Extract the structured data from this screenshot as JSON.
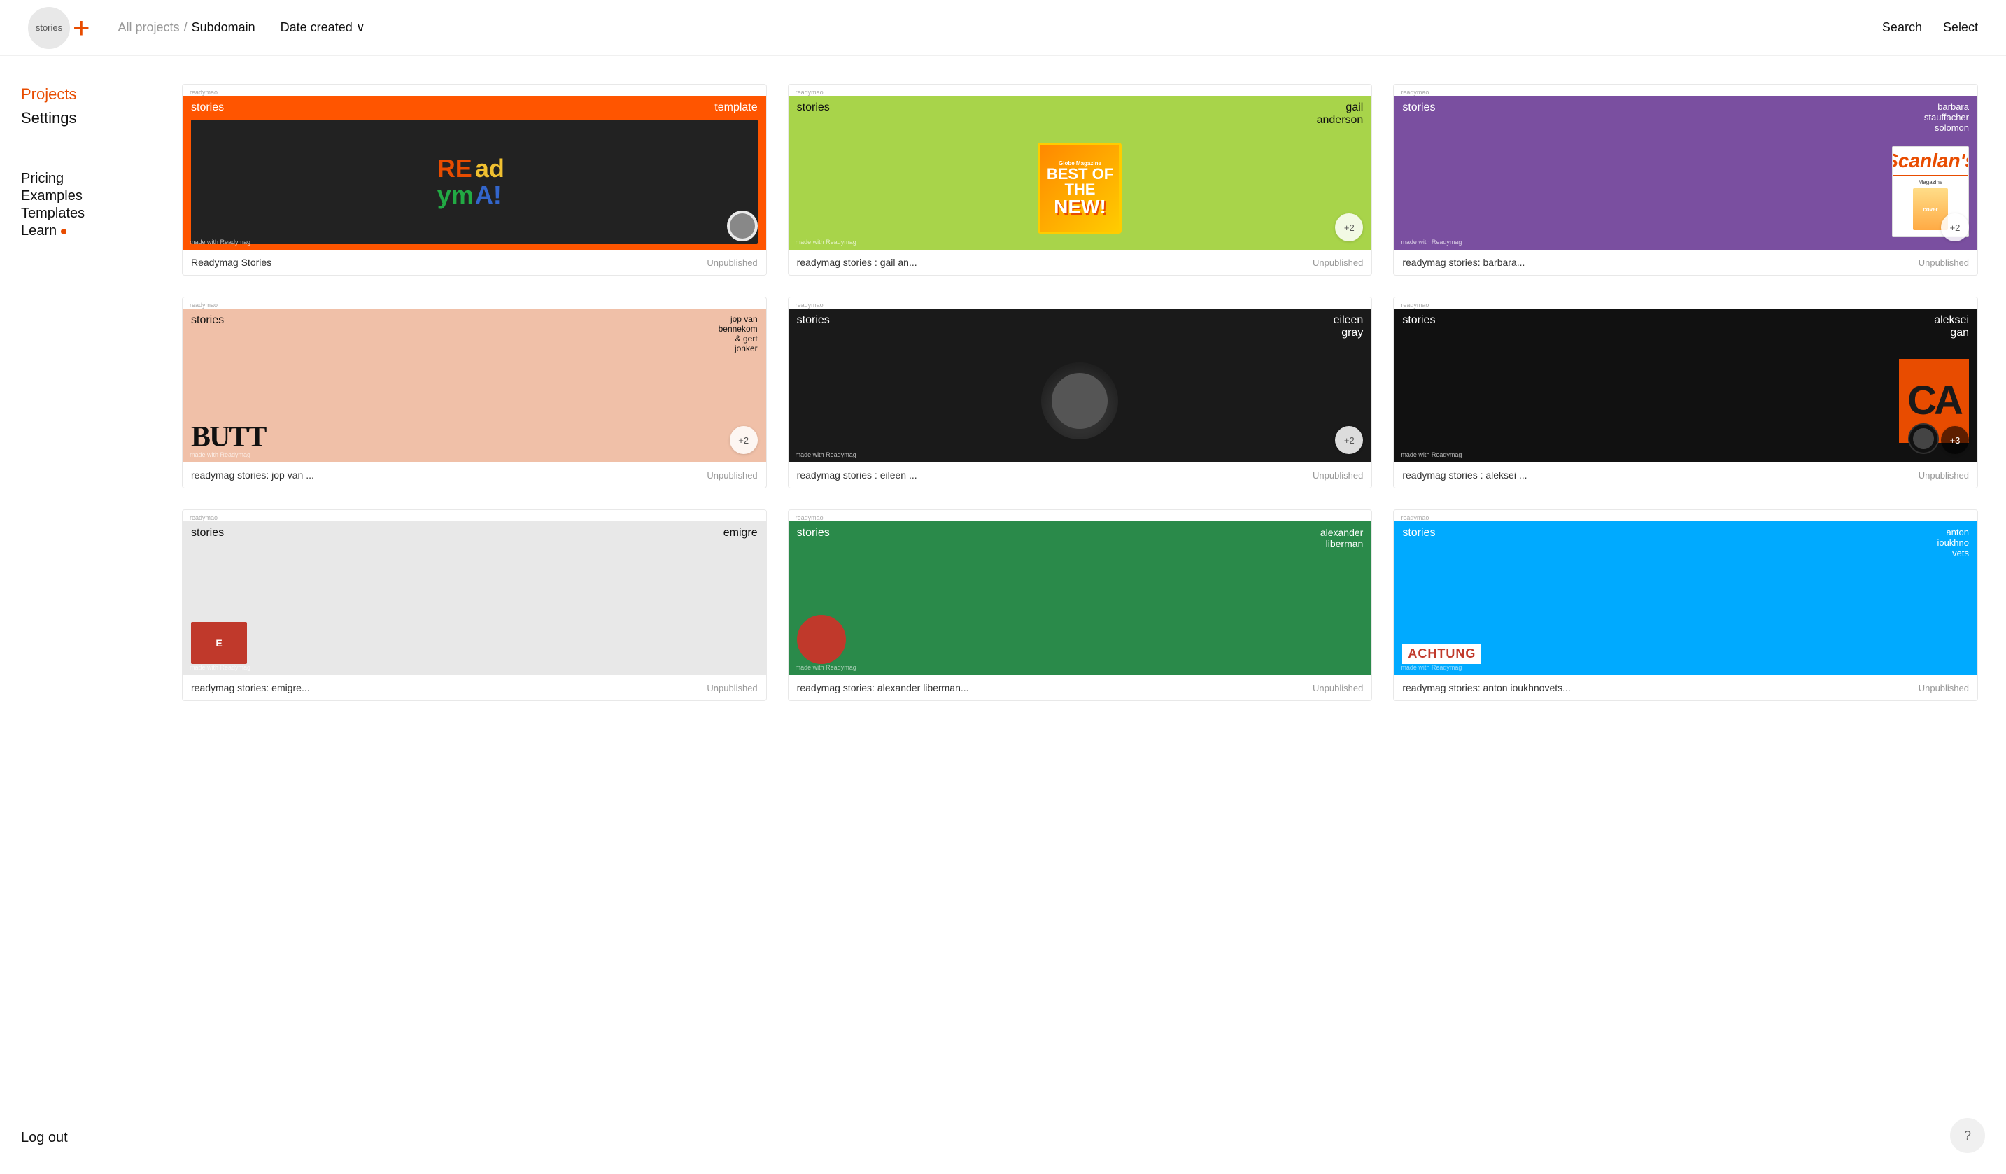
{
  "header": {
    "logo_text": "stories",
    "logo_plus": "+",
    "breadcrumb_all": "All projects",
    "breadcrumb_sep": "/",
    "breadcrumb_current": "Subdomain",
    "date_sort": "Date created ∨",
    "search_label": "Search",
    "select_label": "Select"
  },
  "sidebar": {
    "nav_items": [
      {
        "label": "Projects",
        "active": true
      },
      {
        "label": "Settings",
        "active": false
      }
    ],
    "external_items": [
      {
        "label": "Pricing",
        "badge": false
      },
      {
        "label": "Examples",
        "badge": false
      },
      {
        "label": "Templates",
        "badge": false
      },
      {
        "label": "Learn",
        "badge": true
      }
    ],
    "logout_label": "Log out"
  },
  "projects": [
    {
      "id": 1,
      "top_label": "readymao",
      "title": "Readymag Stories",
      "status": "Unpublished",
      "thumb_type": "template",
      "stories_label": "stories",
      "name_label": "template",
      "badge": null,
      "bg": "#ff5500"
    },
    {
      "id": 2,
      "top_label": "readymao",
      "title": "readymag stories : gail an...",
      "status": "Unpublished",
      "thumb_type": "gail",
      "stories_label": "stories",
      "name_label": "gail anderson",
      "badge": "+2",
      "bg": "#a8d44a"
    },
    {
      "id": 3,
      "top_label": "readymao",
      "title": "readymag stories: barbara...",
      "status": "Unpublished",
      "thumb_type": "barbara",
      "stories_label": "stories",
      "name_label": "barbara stauffacher solomon",
      "badge": "+2",
      "bg": "#7a4fa0"
    },
    {
      "id": 4,
      "top_label": "readymao",
      "title": "readymag stories: jop van ...",
      "status": "Unpublished",
      "thumb_type": "jop",
      "stories_label": "stories",
      "name_label": "jop van bennekom & gert jonker",
      "badge": "+2",
      "bg": "#f0c0a8"
    },
    {
      "id": 5,
      "top_label": "readymao",
      "title": "readymag stories : eileen ...",
      "status": "Unpublished",
      "thumb_type": "eileen",
      "stories_label": "stories",
      "name_label": "eileen gray",
      "badge": "+2",
      "bg": "#1a1a1a"
    },
    {
      "id": 6,
      "top_label": "readymao",
      "title": "readymag stories : aleksei ...",
      "status": "Unpublished",
      "thumb_type": "aleksei",
      "stories_label": "stories",
      "name_label": "aleksei gan",
      "badge": "+3",
      "bg": "#111"
    },
    {
      "id": 7,
      "top_label": "readymao",
      "title": "readymag stories: emigre...",
      "status": "Unpublished",
      "thumb_type": "emigre",
      "stories_label": "stories",
      "name_label": "emigre",
      "badge": null,
      "bg": "#e0e0e0"
    },
    {
      "id": 8,
      "top_label": "readymao",
      "title": "readymag stories: alexander liberman...",
      "status": "Unpublished",
      "thumb_type": "alexander",
      "stories_label": "stories",
      "name_label": "alexander liberman",
      "badge": null,
      "bg": "#2a8a4a"
    },
    {
      "id": 9,
      "top_label": "readymao",
      "title": "readymag stories: anton ioukhnovets...",
      "status": "Unpublished",
      "thumb_type": "anton",
      "stories_label": "stories",
      "name_label": "anton ioukhno vets",
      "badge": null,
      "bg": "#00aaff"
    }
  ],
  "help_label": "?"
}
